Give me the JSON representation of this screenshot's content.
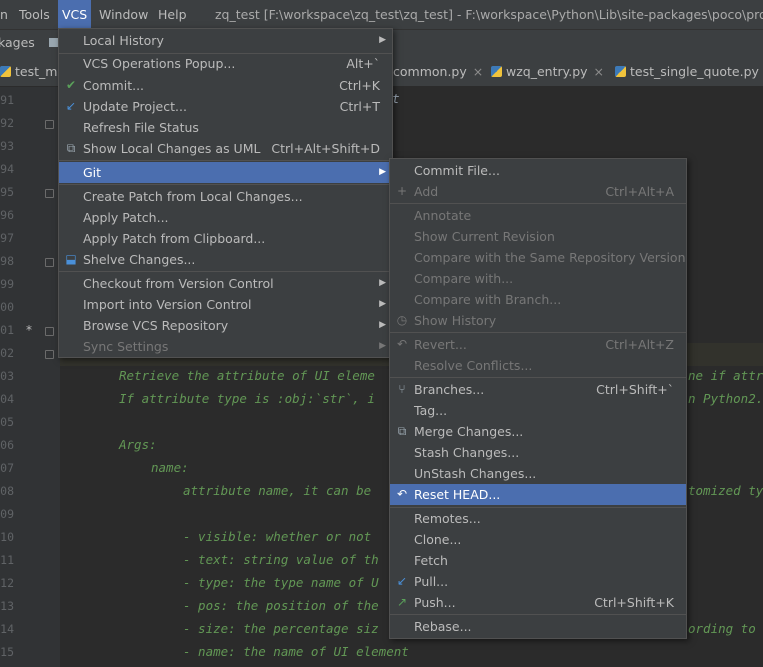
{
  "menubar": {
    "items": [
      "n",
      "Tools",
      "VCS",
      "Window",
      "Help"
    ],
    "title": "zq_test [F:\\workspace\\zq_test\\zq_test] - F:\\workspace\\Python\\Lib\\site-packages\\poco\\proxy.py"
  },
  "navbar": {
    "crumb": "kages"
  },
  "tabs": [
    {
      "label": "test_ma",
      "close": ""
    },
    {
      "label": "common.py",
      "close": "×"
    },
    {
      "label": "wzq_entry.py",
      "close": "×"
    },
    {
      "label": "test_single_quote.py",
      "close": "×"
    }
  ],
  "gutter": {
    "lines": [
      "91",
      "92",
      "93",
      "94",
      "95",
      "96",
      "97",
      "98",
      "99",
      "00",
      "01",
      "02",
      "03",
      "04",
      "05",
      "06",
      "07",
      "08",
      "09",
      "10",
      "11",
      "12",
      "13",
      "14",
      "15"
    ],
    "modified_marker": "*"
  },
  "code": [
    "t",
    "Retrieve the attribute of UI eleme",
    "ne if attr",
    "If attribute type is :obj:`str`, i",
    "n Python2.",
    "Args:",
    "name:",
    "attribute name, it can be",
    "tomized ty",
    "- visible: whether or not",
    "- text: string value of th",
    "- type: the type name of U",
    "- pos: the position of the",
    "- size: the percentage siz",
    "ording to",
    "- name: the name of UI element"
  ],
  "vcs_menu": {
    "items": [
      {
        "label": "Local History",
        "shortcut": "",
        "submenu": true
      },
      {
        "label": "VCS Operations Popup...",
        "shortcut": "Alt+`"
      },
      {
        "label": "Commit...",
        "shortcut": "Ctrl+K",
        "icon": "check-icon"
      },
      {
        "label": "Update Project...",
        "shortcut": "Ctrl+T",
        "icon": "update-icon"
      },
      {
        "label": "Refresh File Status",
        "shortcut": ""
      },
      {
        "label": "Show Local Changes as UML",
        "shortcut": "Ctrl+Alt+Shift+D",
        "icon": "uml-icon"
      },
      {
        "label": "Git",
        "shortcut": "",
        "submenu": true
      },
      {
        "label": "Create Patch from Local Changes...",
        "shortcut": ""
      },
      {
        "label": "Apply Patch...",
        "shortcut": ""
      },
      {
        "label": "Apply Patch from Clipboard...",
        "shortcut": ""
      },
      {
        "label": "Shelve Changes...",
        "shortcut": "",
        "icon": "shelve-icon"
      },
      {
        "label": "Checkout from Version Control",
        "shortcut": "",
        "submenu": true
      },
      {
        "label": "Import into Version Control",
        "shortcut": "",
        "submenu": true
      },
      {
        "label": "Browse VCS Repository",
        "shortcut": "",
        "submenu": true
      },
      {
        "label": "Sync Settings",
        "shortcut": "",
        "submenu": true
      }
    ]
  },
  "git_menu": {
    "items": [
      {
        "label": "Commit File...",
        "shortcut": ""
      },
      {
        "label": "Add",
        "shortcut": "Ctrl+Alt+A"
      },
      {
        "label": "Annotate",
        "shortcut": ""
      },
      {
        "label": "Show Current Revision",
        "shortcut": ""
      },
      {
        "label": "Compare with the Same Repository Version",
        "shortcut": ""
      },
      {
        "label": "Compare with...",
        "shortcut": ""
      },
      {
        "label": "Compare with Branch...",
        "shortcut": ""
      },
      {
        "label": "Show History",
        "shortcut": ""
      },
      {
        "label": "Revert...",
        "shortcut": "Ctrl+Alt+Z"
      },
      {
        "label": "Resolve Conflicts...",
        "shortcut": ""
      },
      {
        "label": "Branches...",
        "shortcut": "Ctrl+Shift+`"
      },
      {
        "label": "Tag...",
        "shortcut": ""
      },
      {
        "label": "Merge Changes...",
        "shortcut": ""
      },
      {
        "label": "Stash Changes...",
        "shortcut": ""
      },
      {
        "label": "UnStash Changes...",
        "shortcut": ""
      },
      {
        "label": "Reset HEAD...",
        "shortcut": ""
      },
      {
        "label": "Remotes...",
        "shortcut": ""
      },
      {
        "label": "Clone...",
        "shortcut": ""
      },
      {
        "label": "Fetch",
        "shortcut": ""
      },
      {
        "label": "Pull...",
        "shortcut": ""
      },
      {
        "label": "Push...",
        "shortcut": "Ctrl+Shift+K"
      },
      {
        "label": "Rebase...",
        "shortcut": ""
      }
    ]
  },
  "colors": {
    "selection": "#4b6eaf",
    "menu_bg": "#3c3f41",
    "editor_bg": "#2b2b2b",
    "docstring": "#629755"
  }
}
